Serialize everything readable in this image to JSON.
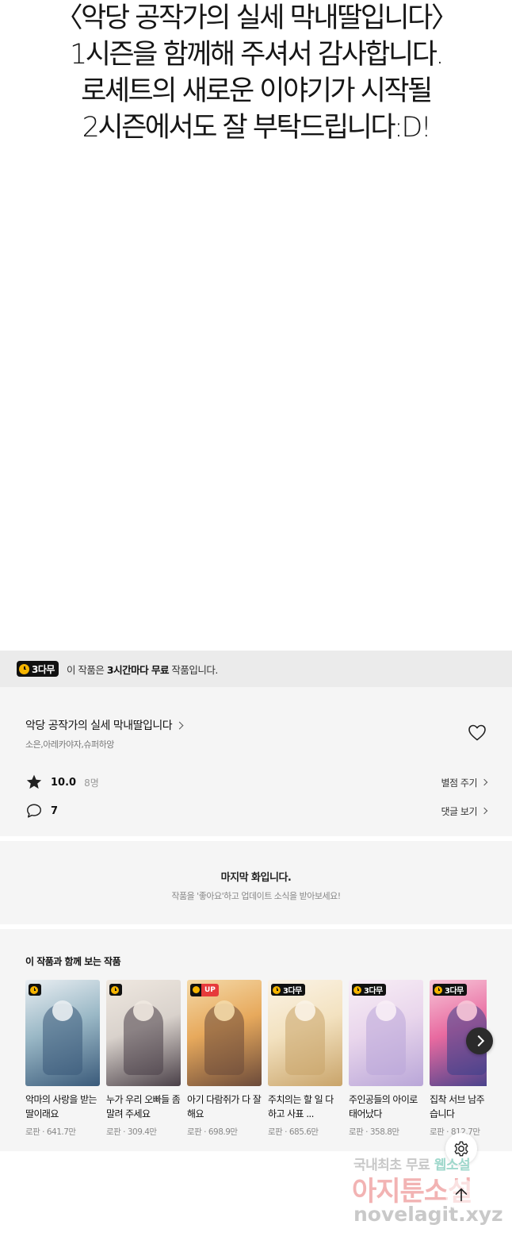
{
  "closing_message": {
    "lines": [
      "〈악당 공작가의 실세 막내딸입니다〉",
      "1시즌을 함께해 주셔서 감사합니다.",
      "로셰트의 새로운 이야기가 시작될",
      "2시즌에서도 잘 부탁드립니다:D!"
    ]
  },
  "free_banner": {
    "badge": "3다무",
    "text_prefix": "이 작품은 ",
    "text_bold": "3시간마다 무료",
    "text_suffix": " 작품입니다."
  },
  "work": {
    "title": "악당 공작가의 실세 막내딸입니다",
    "authors": "소은,아레카야자,슈퍼하앙",
    "rating": "10.0",
    "raters": "8명",
    "rate_link": "별점 주기",
    "comments": "7",
    "comments_link": "댓글 보기"
  },
  "last_episode": {
    "title": "마지막 화입니다.",
    "subtitle": "작품을 '좋아요'하고 업데이트 소식을 받아보세요!"
  },
  "recommendations": {
    "heading": "이 작품과 함께 보는 작품",
    "items": [
      {
        "title": "악마의 사랑을 받는 딸이래요",
        "meta": "로판 · 641.7만",
        "badge": "clock",
        "badge_text": "",
        "colors": [
          "#3a5a7a",
          "#9ab8c6",
          "#e9eef2"
        ]
      },
      {
        "title": "누가 우리 오빠들 좀 말려 주세요",
        "meta": "로판 · 309.4만",
        "badge": "clock",
        "badge_text": "",
        "colors": [
          "#4a4048",
          "#d9d2cc",
          "#efe8e0"
        ]
      },
      {
        "title": "아기 다람쥐가 다 잘해요",
        "meta": "로판 · 698.9만",
        "badge": "up",
        "badge_text": "UP",
        "colors": [
          "#6b4a3a",
          "#e7a95c",
          "#f4d9a8"
        ]
      },
      {
        "title": "주치의는 할 일 다 하고 사표 ...",
        "meta": "로판 · 685.6만",
        "badge": "3damu",
        "badge_text": "3다무",
        "colors": [
          "#c9a46a",
          "#f3e2c0",
          "#fbf3e6"
        ]
      },
      {
        "title": "주인공들의 아이로 태어났다",
        "meta": "로판 · 358.8만",
        "badge": "3damu",
        "badge_text": "3다무",
        "colors": [
          "#b9a6d8",
          "#e9d6ec",
          "#f8eef6"
        ]
      },
      {
        "title": "집착 서브 남주 키웠습니다",
        "meta": "로판 · 812.7만",
        "badge": "3damu",
        "badge_text": "3다무",
        "colors": [
          "#3a3f8a",
          "#e86aa0",
          "#f7c6d8"
        ]
      }
    ]
  },
  "watermark": {
    "line1_a": "국내최초 무료 ",
    "line1_b": "웹소설",
    "line2": "아지툰소설",
    "line3": "novelagit.xyz"
  },
  "icons": {
    "heart": "heart-icon",
    "star": "star-icon",
    "comment": "comment-icon",
    "next": "chevron-right-icon",
    "settings": "gear-icon",
    "top": "arrow-up-icon"
  }
}
